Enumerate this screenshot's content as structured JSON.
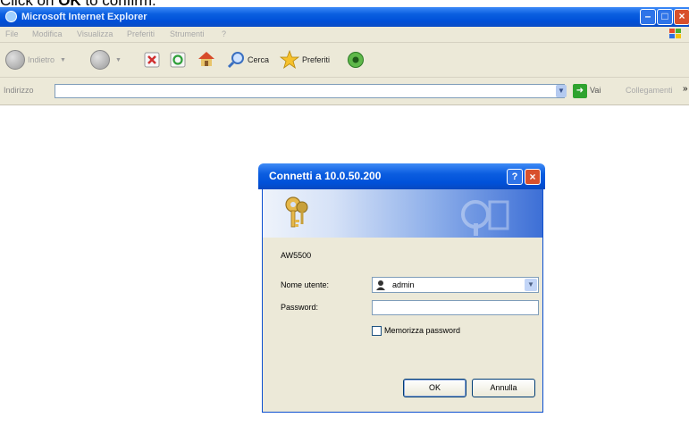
{
  "caption": {
    "prefix": "Click on ",
    "bold": "OK",
    "suffix": " to confirm."
  },
  "ie": {
    "title": "Microsoft Internet Explorer",
    "menu": [
      "File",
      "Modifica",
      "Visualizza",
      "Preferiti",
      "Strumenti",
      "?"
    ],
    "toolbar": {
      "back": "Indietro",
      "search": "Cerca",
      "favorites": "Preferiti"
    },
    "address": {
      "label": "Indirizzo",
      "value": "",
      "go": "Vai",
      "links": "Collegamenti"
    }
  },
  "dialog": {
    "title": "Connetti a 10.0.50.200",
    "realm": "AW5500",
    "username_label": "Nome utente:",
    "username_value": "admin",
    "password_label": "Password:",
    "remember_label": "Memorizza password",
    "remember_checked": false,
    "ok": "OK",
    "cancel": "Annulla"
  },
  "colors": {
    "xp_blue": "#0050d8",
    "dialog_bg": "#ece9d8",
    "close_red": "#d8502c"
  }
}
